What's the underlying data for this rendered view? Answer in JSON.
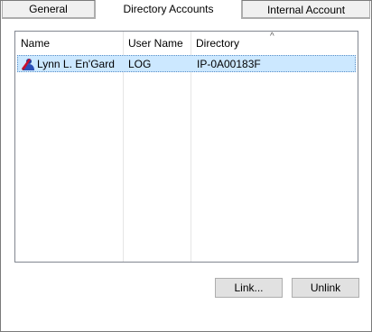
{
  "tabs": [
    {
      "label": "General"
    },
    {
      "label": "Directory Accounts"
    },
    {
      "label": "Internal Account"
    }
  ],
  "columns": [
    {
      "label": "Name"
    },
    {
      "label": "User Name"
    },
    {
      "label": "Directory"
    }
  ],
  "sort_indicator": "^",
  "rows": [
    {
      "name": "Lynn L. En'Gard",
      "user_name": "LOG",
      "directory": "IP-0A00183F",
      "icon": "user-account-icon",
      "selected": true
    }
  ],
  "buttons": {
    "link_label": "Link...",
    "unlink_label": "Unlink"
  },
  "colors": {
    "selection_bg": "#cce8ff",
    "button_bg": "#e1e1e1"
  }
}
